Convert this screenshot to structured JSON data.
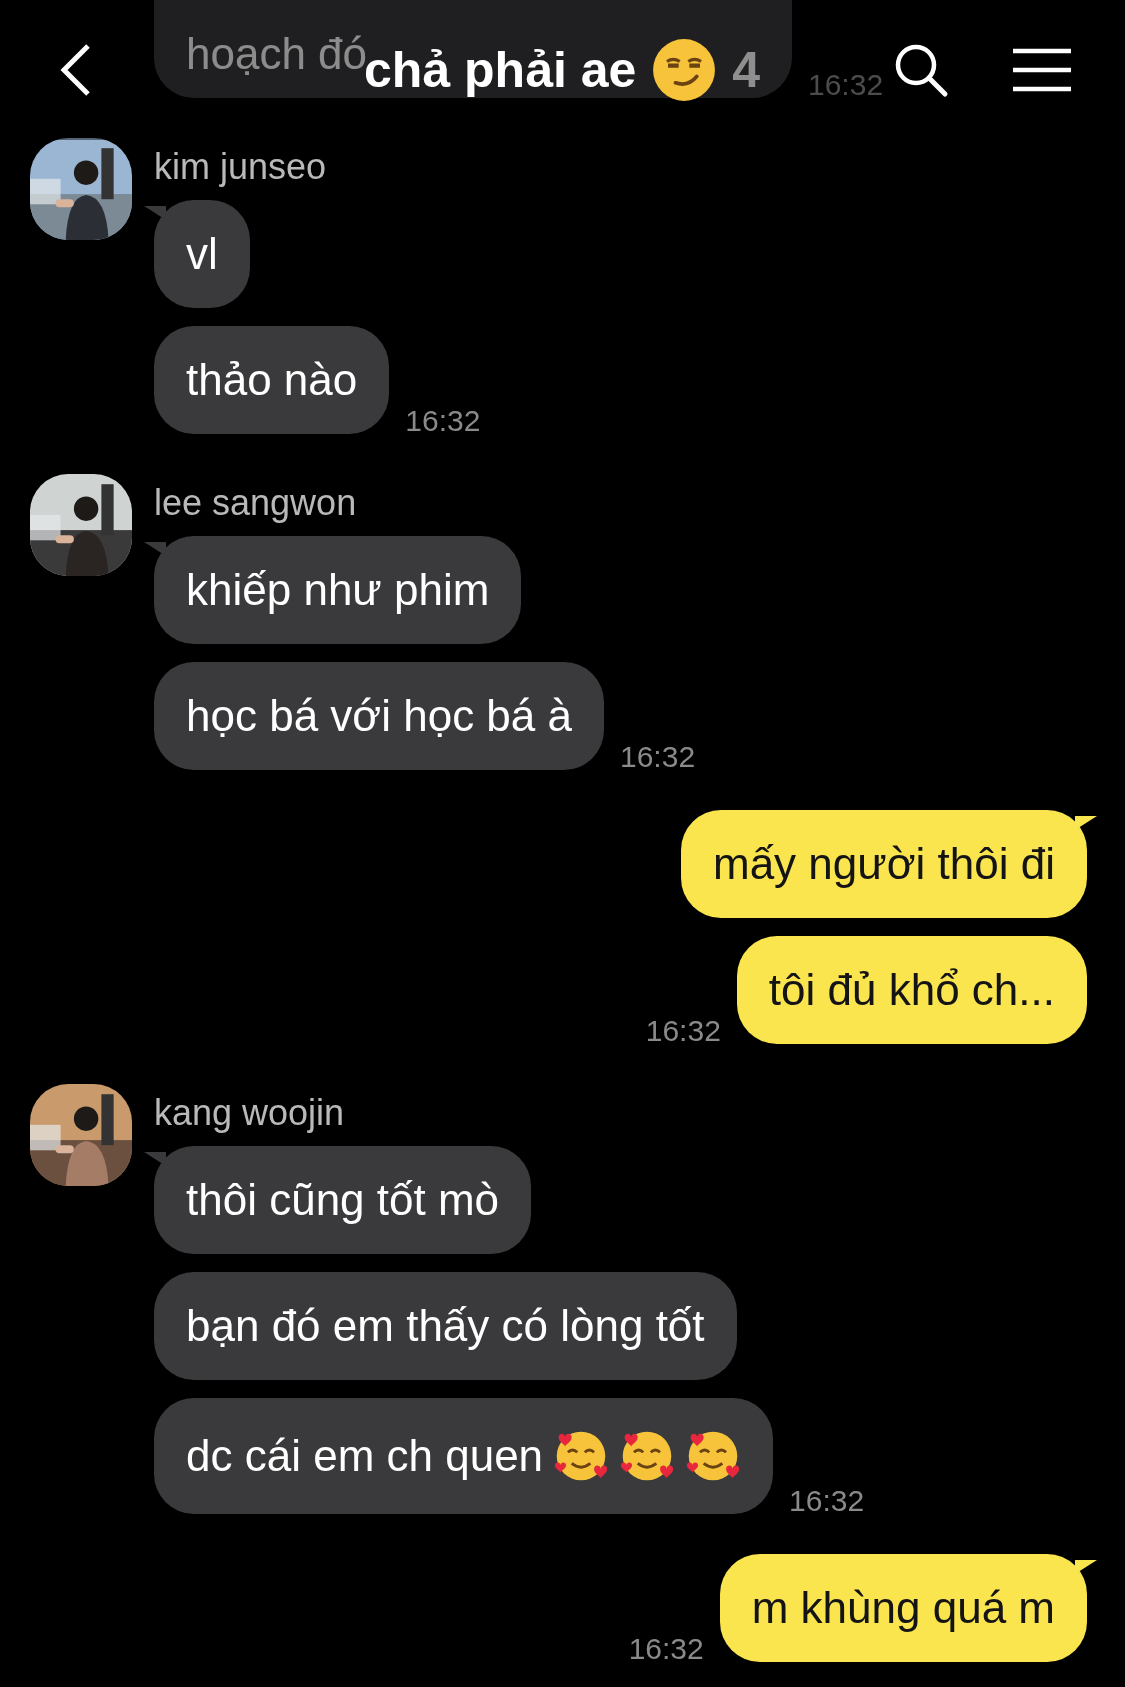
{
  "header": {
    "title": "chả phải ae",
    "title_icon": {
      "kind": "smirk"
    },
    "member_count": "4"
  },
  "groups": [
    {
      "kind": "incoming",
      "messages": [
        {
          "text": "hoạch đó"
        }
      ],
      "time": "16:32"
    },
    {
      "kind": "incoming",
      "name": "kim junseo",
      "messages": [
        {
          "text": "vl"
        },
        {
          "text": "thảo nào"
        }
      ],
      "time": "16:32"
    },
    {
      "kind": "incoming",
      "name": "lee sangwon",
      "messages": [
        {
          "text": "khiếp như phim"
        },
        {
          "text": "học bá với học bá à"
        }
      ],
      "time": "16:32"
    },
    {
      "kind": "outgoing",
      "messages": [
        {
          "text": "mấy người thôi đi"
        },
        {
          "text": "tôi đủ khổ ch..."
        }
      ],
      "time": "16:32"
    },
    {
      "kind": "incoming",
      "name": "kang woojin",
      "messages": [
        {
          "text": "thôi cũng tốt mò"
        },
        {
          "text": "bạn đó em thấy có lòng tốt"
        },
        {
          "text": "dc cái em ch quen",
          "emojis": [
            {
              "kind": "smiling_hearts"
            },
            {
              "kind": "smiling_hearts"
            },
            {
              "kind": "smiling_hearts"
            }
          ]
        }
      ],
      "time": "16:32"
    },
    {
      "kind": "outgoing",
      "messages": [
        {
          "text": "m khùng quá m"
        }
      ],
      "time": "16:32"
    }
  ]
}
